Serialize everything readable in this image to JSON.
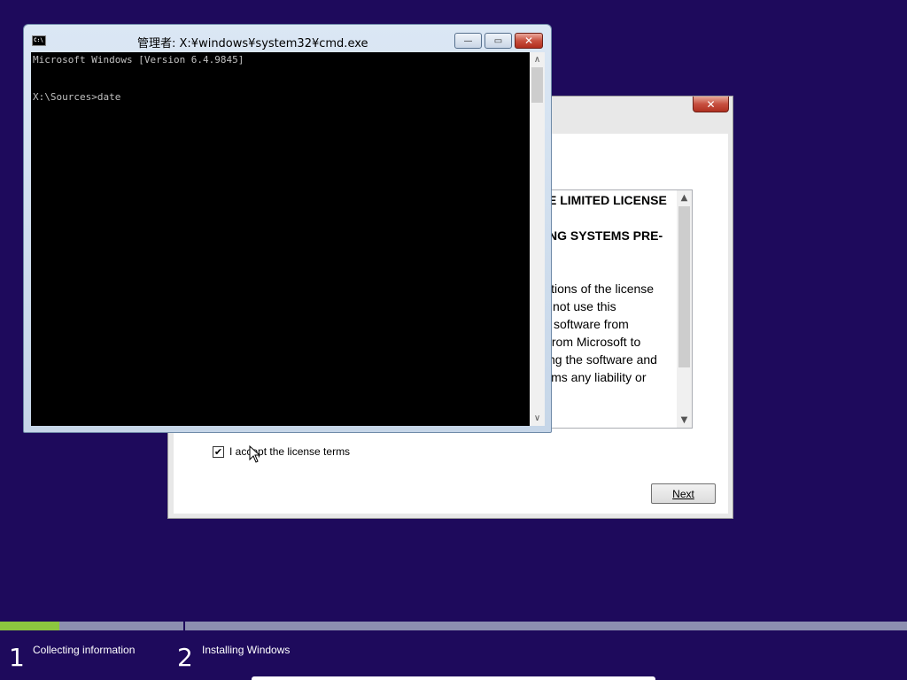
{
  "setup": {
    "close_glyph": "✕",
    "license_lines_bold": [
      "E LIMITED LICENSE",
      "NG SYSTEMS PRE-"
    ],
    "license_lines": [
      "itions of the license",
      "not use this",
      "software from",
      "from Microsoft to",
      "ng the software and",
      "ims any liability or"
    ],
    "accept_checked_glyph": "✔",
    "accept_label": "I accept the license terms",
    "next_label": "Next"
  },
  "cmd": {
    "title": "管理者: X:¥windows¥system32¥cmd.exe",
    "icon_text": "C:\\",
    "minimize_glyph": "—",
    "maximize_glyph": "▭",
    "close_glyph": "✕",
    "output": "Microsoft Windows [Version 6.4.9845]\n\n\nX:\\Sources>date"
  },
  "progress": {
    "fraction": 0.065,
    "steps": [
      {
        "number": "1",
        "label": "Collecting information"
      },
      {
        "number": "2",
        "label": "Installing Windows"
      }
    ]
  },
  "colors": {
    "desktop": "#1e0a5c",
    "progress_fill": "#8cc63f",
    "progress_track": "#8d8fb0"
  }
}
